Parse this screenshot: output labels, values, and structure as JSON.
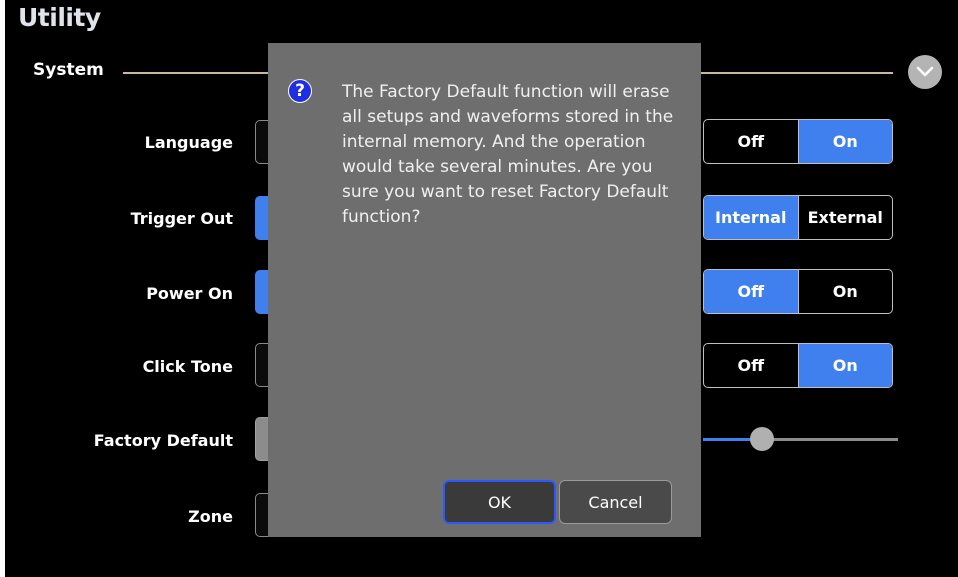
{
  "app": {
    "title": "Utility"
  },
  "section": {
    "label": "System",
    "collapse_icon": "chevron-down-icon"
  },
  "rows": [
    {
      "label": "Language"
    },
    {
      "label": "Trigger Out"
    },
    {
      "label": "Power On"
    },
    {
      "label": "Click Tone"
    },
    {
      "label": "Factory Default"
    },
    {
      "label": "Zone"
    }
  ],
  "toggles": {
    "t1": {
      "a": "Off",
      "b": "On",
      "selected": "On"
    },
    "t2": {
      "a": "Internal",
      "b": "External",
      "selected": "Internal"
    },
    "t3": {
      "a": "Off",
      "b": "On",
      "selected": "Off"
    },
    "t4": {
      "a": "Off",
      "b": "On",
      "selected": "On"
    }
  },
  "slider": {
    "value": 0.3
  },
  "dialog": {
    "icon": "question-icon",
    "icon_glyph": "?",
    "message": "The Factory Default function will erase all setups and waveforms stored in the internal memory. And the operation would take several minutes. Are you sure you want to reset Factory Default function?",
    "ok_label": "OK",
    "cancel_label": "Cancel"
  },
  "colors": {
    "accent": "#3f80ee",
    "dialog_bg": "#6e6e6e",
    "divider": "#c8b99a"
  }
}
